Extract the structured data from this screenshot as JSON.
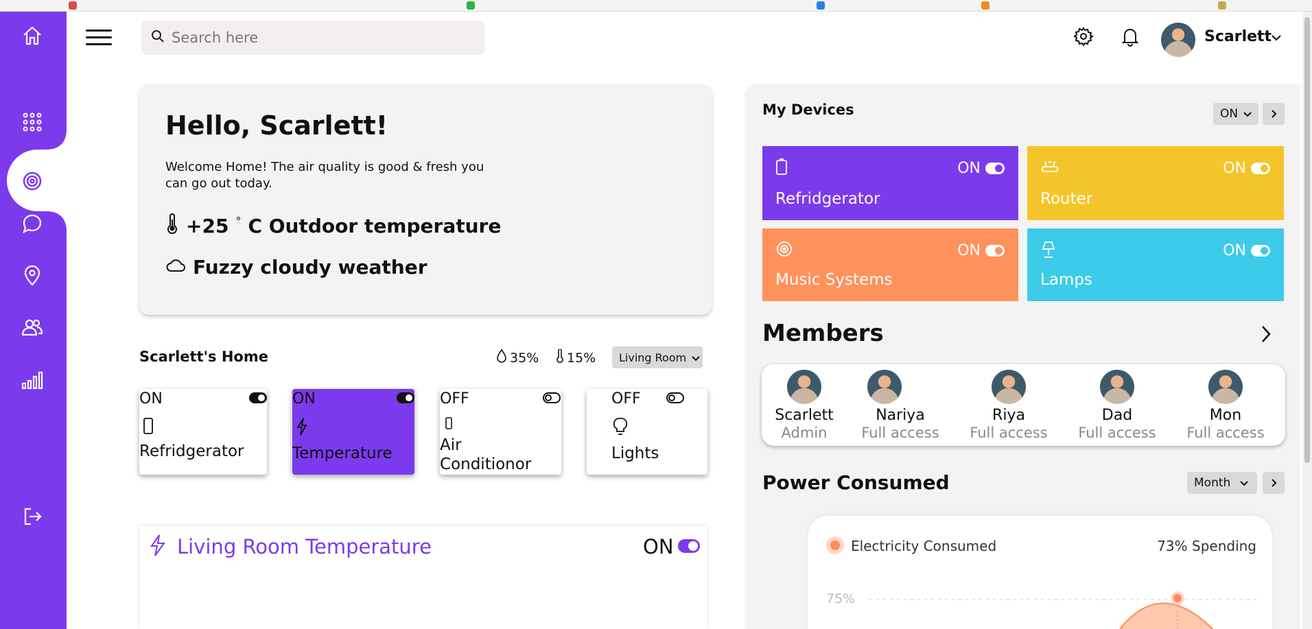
{
  "search": {
    "placeholder": "Search here"
  },
  "user": {
    "name": "Scarlett"
  },
  "hello": {
    "title": "Hello, Scarlett!",
    "message": "Welcome Home! The air quality is good & fresh you can go out today.",
    "temperature_value": "+25",
    "temperature_unit": "°",
    "temperature_label": "C Outdoor temperature",
    "weather": "Fuzzy cloudy weather"
  },
  "home": {
    "title": "Scarlett's Home",
    "humidity": "35%",
    "temperature": "15%",
    "room_select": "Living Room",
    "devices": [
      {
        "state": "ON",
        "name": "Refridgerator",
        "on": true,
        "active": false
      },
      {
        "state": "ON",
        "name": "Temperature",
        "on": true,
        "active": true
      },
      {
        "state": "OFF",
        "name": "Air Conditionor",
        "on": false,
        "active": false
      },
      {
        "state": "OFF",
        "name": "Lights",
        "on": false,
        "active": false
      }
    ]
  },
  "living_room": {
    "title": "Living Room Temperature",
    "state": "ON"
  },
  "my_devices": {
    "title": "My Devices",
    "select": "ON",
    "items": [
      {
        "name": "Refridgerator",
        "state": "ON",
        "color": "#7c3aed"
      },
      {
        "name": "Router",
        "state": "ON",
        "color": "#f4c52a"
      },
      {
        "name": "Music Systems",
        "state": "ON",
        "color": "#ff915c"
      },
      {
        "name": "Lamps",
        "state": "ON",
        "color": "#3ccbe8"
      }
    ]
  },
  "members": {
    "title": "Members",
    "list": [
      {
        "name": "Scarlett",
        "role": "Admin"
      },
      {
        "name": "Nariya",
        "role": "Full access"
      },
      {
        "name": "Riya",
        "role": "Full access"
      },
      {
        "name": "Dad",
        "role": "Full access"
      },
      {
        "name": "Mon",
        "role": "Full access"
      }
    ]
  },
  "power": {
    "title": "Power Consumed",
    "select": "Month",
    "legend": "Electricity Consumed",
    "spending": "73% Spending",
    "axis_label": "75%"
  },
  "colors": {
    "accent": "#7c3aed",
    "panel": "#f3f3f3"
  }
}
